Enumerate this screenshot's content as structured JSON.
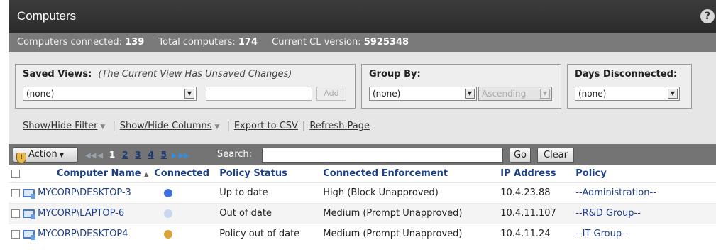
{
  "header": {
    "title": "Computers",
    "help_icon": "?"
  },
  "stats": [
    {
      "label": "Computers connected:",
      "value": "139"
    },
    {
      "label": "Total computers:",
      "value": "174"
    },
    {
      "label": "Current CL version:",
      "value": "5925348"
    }
  ],
  "filters": {
    "saved_views": {
      "label": "Saved Views:",
      "note": "(The Current View Has Unsaved Changes)",
      "selected": "(none)",
      "add_label": "Add"
    },
    "group_by": {
      "label": "Group By:",
      "selected": "(none)",
      "order": "Ascending"
    },
    "days_disconnected": {
      "label": "Days Disconnected:",
      "selected": "(none)"
    }
  },
  "links": {
    "show_hide_filter": "Show/Hide Filter",
    "show_hide_columns": "Show/Hide Columns",
    "export_csv": "Export to CSV",
    "refresh": "Refresh Page"
  },
  "toolbar": {
    "action_label": "Action",
    "pages": [
      "1",
      "2",
      "3",
      "4",
      "5"
    ],
    "search_label": "Search:",
    "search_value": "",
    "go_label": "Go",
    "clear_label": "Clear"
  },
  "table": {
    "columns": {
      "name": "Computer Name",
      "connected": "Connected",
      "policy_status": "Policy Status",
      "enforcement": "Connected Enforcement",
      "ip": "IP Address",
      "policy": "Policy"
    },
    "rows": [
      {
        "name": "MYCORP\\DESKTOP-3",
        "connected_color": "#3f6fe0",
        "policy_status": "Up to date",
        "enforcement": "High (Block Unapproved)",
        "ip": "10.4.23.88",
        "policy": "--Administration--"
      },
      {
        "name": "MYCORP\\LAPTOP-6",
        "connected_color": "#c9d6f2",
        "policy_status": "Out of date",
        "enforcement": "Medium (Prompt Unapproved)",
        "ip": "10.4.11.107",
        "policy": "--R&D Group--"
      },
      {
        "name": "MYCORP\\DESKTOP4",
        "connected_color": "#d9a43a",
        "policy_status": "Policy out of date",
        "enforcement": "Medium (Prompt Unapproved)",
        "ip": "10.4.11.24",
        "policy": "--IT Group--"
      }
    ]
  }
}
